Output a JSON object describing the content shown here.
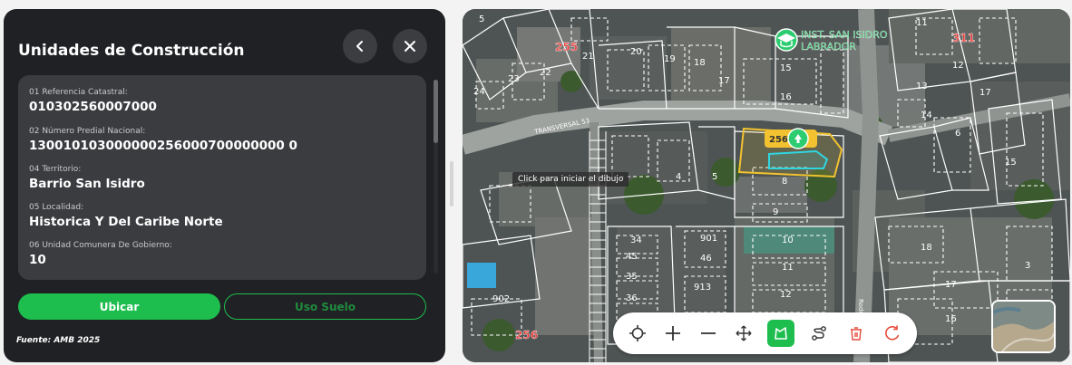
{
  "panel": {
    "title": "Unidades de Construcción",
    "fields": [
      {
        "label": "01 Referencia Catastral:",
        "value": "010302560007000"
      },
      {
        "label": "02 Número Predial Nacional:",
        "value": "130010103000000256000700000000 0"
      },
      {
        "label": "04 Territorio:",
        "value": "Barrio San Isidro"
      },
      {
        "label": "05 Localidad:",
        "value": "Historica Y Del Caribe Norte"
      },
      {
        "label": "06 Unidad Comunera De Gobierno:",
        "value": "10"
      }
    ],
    "buttons": {
      "ubicar": "Ubicar",
      "uso_suelo": "Uso Suelo"
    },
    "source": "Fuente: AMB 2025"
  },
  "map": {
    "tooltip": "Click para iniciar el dibujo",
    "poi": "INST. SAN ISIDRO LABRADOR",
    "poi_line1": "INST. SAN ISIDRO",
    "poi_line2": "LABRADOR",
    "street_1": "TRANSVERSAL 53",
    "street_2": "Rodriguez",
    "sector_labels": [
      "255",
      "311",
      "256"
    ],
    "selected_parcel": "256",
    "parcel_numbers": [
      "5",
      "21",
      "20",
      "19",
      "18",
      "17",
      "15",
      "16",
      "22",
      "23",
      "24",
      "13",
      "12",
      "11",
      "14",
      "6",
      "15",
      "17",
      "4",
      "5",
      "8",
      "9",
      "901",
      "10",
      "11",
      "34",
      "45",
      "35",
      "36",
      "46",
      "913",
      "12",
      "902",
      "18",
      "17",
      "16",
      "3"
    ],
    "icons": [
      "school-icon",
      "location-pin-icon"
    ]
  },
  "toolbar": {
    "tools": [
      "crosshair-icon",
      "zoom-in-icon",
      "zoom-out-icon",
      "pan-icon",
      "draw-polygon-icon",
      "draw-line-icon",
      "delete-icon",
      "reset-icon"
    ],
    "active_tool": "draw-polygon-icon"
  },
  "colors": {
    "panel_bg": "#202124",
    "card_bg": "#3b3c40",
    "accent_green": "#1dbd4e",
    "sector_label_red": "#e53935",
    "selected_parcel_yellow": "#f2c230",
    "selected_parcel_cyan": "#2fd6e0",
    "poi_green": "#2ecc71",
    "delete_red": "#e74c3c"
  }
}
